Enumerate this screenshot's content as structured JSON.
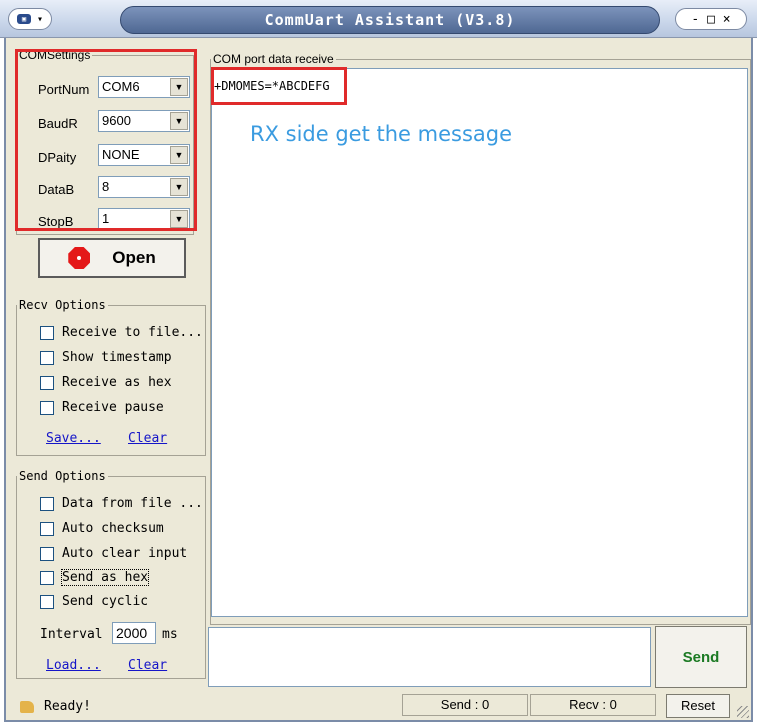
{
  "window": {
    "title": "CommUart Assistant (V3.8)",
    "win_controls": "- □ ×"
  },
  "com_settings": {
    "legend": "COMSettings",
    "rows": [
      {
        "label": "PortNum",
        "value": "COM6"
      },
      {
        "label": "BaudR",
        "value": "9600"
      },
      {
        "label": "DPaity",
        "value": "NONE"
      },
      {
        "label": "DataB",
        "value": "8"
      },
      {
        "label": "StopB",
        "value": "1"
      }
    ]
  },
  "open_button": {
    "label": "Open"
  },
  "recv_options": {
    "legend": "Recv Options",
    "items": [
      {
        "label": "Receive to file...",
        "checked": false
      },
      {
        "label": "Show timestamp",
        "checked": false
      },
      {
        "label": "Receive as hex",
        "checked": false
      },
      {
        "label": "Receive pause",
        "checked": false
      }
    ],
    "save_link": "Save...",
    "clear_link": "Clear"
  },
  "send_options": {
    "legend": "Send Options",
    "items": [
      {
        "label": "Data from file ...",
        "checked": false
      },
      {
        "label": "Auto checksum",
        "checked": false
      },
      {
        "label": "Auto clear input",
        "checked": false
      },
      {
        "label": "Send as hex",
        "checked": false
      },
      {
        "label": "Send cyclic",
        "checked": false
      }
    ],
    "interval_label": "Interval",
    "interval_value": "2000",
    "interval_unit": "ms",
    "load_link": "Load...",
    "clear_link": "Clear"
  },
  "receive_panel": {
    "legend": "COM port data receive",
    "content": "+DMOMES=*ABCDEFG",
    "annotation": "RX side get the message"
  },
  "send_panel": {
    "button": "Send",
    "input_value": ""
  },
  "status": {
    "ready": "Ready!",
    "send_count": "Send : 0",
    "recv_count": "Recv : 0",
    "reset": "Reset"
  },
  "colors": {
    "highlight": "#e02a2a",
    "annotation": "#3a9be0",
    "link": "#1515c8",
    "send_button_text": "#1b7a23"
  }
}
